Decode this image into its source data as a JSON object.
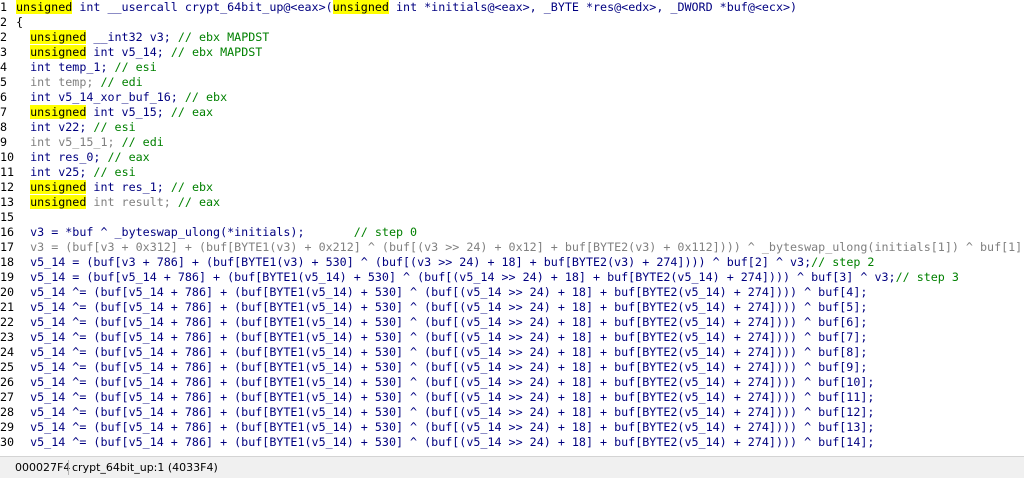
{
  "code": {
    "header": {
      "l1": "unsigned",
      "l2": " int __usercall crypt_64bit_up@<eax>(",
      "l3": "unsigned",
      "l4": " int *initials@<eax>, _BYTE *res@<edx>, _DWORD *buf@<ecx>)"
    },
    "brace": "{",
    "decls": [
      {
        "n": "2",
        "kw": "unsigned",
        "type": " __int32 v3; ",
        "cmt": "// ebx MAPDST"
      },
      {
        "n": "3",
        "kw": "unsigned",
        "type": " int v5_14; ",
        "cmt": "// ebx MAPDST"
      },
      {
        "n": "4",
        "kw": "",
        "type": "int temp_1; ",
        "cmt": "// esi"
      },
      {
        "n": "5",
        "kw": "",
        "type": "int temp; ",
        "cmt": "// edi",
        "gray": true
      },
      {
        "n": "6",
        "kw": "",
        "type": "int v5_14_xor_buf_16; ",
        "cmt": "// ebx"
      },
      {
        "n": "7",
        "kw": "unsigned",
        "type": " int v5_15; ",
        "cmt": "// eax"
      },
      {
        "n": "8",
        "kw": "",
        "type": "int v22; ",
        "cmt": "// esi"
      },
      {
        "n": "9",
        "kw": "",
        "type": "int v5_15_1; ",
        "cmt": "// edi",
        "gray": true
      },
      {
        "n": "10",
        "kw": "",
        "type": "int res_0; ",
        "cmt": "// eax"
      },
      {
        "n": "11",
        "kw": "",
        "type": "int v25; ",
        "cmt": "// esi"
      },
      {
        "n": "12",
        "kw": "unsigned",
        "type": " int res_1; ",
        "cmt": "// ebx"
      },
      {
        "n": "13",
        "kw": "unsigned",
        "type": " int result; ",
        "cmt": "// eax",
        "gray": true
      }
    ],
    "stmts": [
      {
        "n": "16",
        "code": "v3 = *buf ^ _byteswap_ulong(*initials);       ",
        "cmt": "// step 0"
      },
      {
        "n": "17",
        "code": "v3 = (buf[v3 + 0x312] + (buf[BYTE1(v3) + 0x212] ^ (buf[(v3 >> 24) + 0x12] + buf[BYTE2(v3) + 0x112]))) ^ _byteswap_ulong(initials[1]) ^ buf[1];",
        "cmt": "",
        "gray": true
      },
      {
        "n": "18",
        "code": "v5_14 = (buf[v3 + 786] + (buf[BYTE1(v3) + 530] ^ (buf[(v3 >> 24) + 18] + buf[BYTE2(v3) + 274]))) ^ buf[2] ^ v3;",
        "cmt": "// step 2"
      },
      {
        "n": "19",
        "code": "v5_14 = (buf[v5_14 + 786] + (buf[BYTE1(v5_14) + 530] ^ (buf[(v5_14 >> 24) + 18] + buf[BYTE2(v5_14) + 274]))) ^ buf[3] ^ v3;",
        "cmt": "// step 3"
      },
      {
        "n": "20",
        "code": "v5_14 ^= (buf[v5_14 + 786] + (buf[BYTE1(v5_14) + 530] ^ (buf[(v5_14 >> 24) + 18] + buf[BYTE2(v5_14) + 274]))) ^ buf[4];",
        "cmt": ""
      },
      {
        "n": "21",
        "code": "v5_14 ^= (buf[v5_14 + 786] + (buf[BYTE1(v5_14) + 530] ^ (buf[(v5_14 >> 24) + 18] + buf[BYTE2(v5_14) + 274]))) ^ buf[5];",
        "cmt": ""
      },
      {
        "n": "22",
        "code": "v5_14 ^= (buf[v5_14 + 786] + (buf[BYTE1(v5_14) + 530] ^ (buf[(v5_14 >> 24) + 18] + buf[BYTE2(v5_14) + 274]))) ^ buf[6];",
        "cmt": ""
      },
      {
        "n": "23",
        "code": "v5_14 ^= (buf[v5_14 + 786] + (buf[BYTE1(v5_14) + 530] ^ (buf[(v5_14 >> 24) + 18] + buf[BYTE2(v5_14) + 274]))) ^ buf[7];",
        "cmt": ""
      },
      {
        "n": "24",
        "code": "v5_14 ^= (buf[v5_14 + 786] + (buf[BYTE1(v5_14) + 530] ^ (buf[(v5_14 >> 24) + 18] + buf[BYTE2(v5_14) + 274]))) ^ buf[8];",
        "cmt": ""
      },
      {
        "n": "25",
        "code": "v5_14 ^= (buf[v5_14 + 786] + (buf[BYTE1(v5_14) + 530] ^ (buf[(v5_14 >> 24) + 18] + buf[BYTE2(v5_14) + 274]))) ^ buf[9];",
        "cmt": ""
      },
      {
        "n": "26",
        "code": "v5_14 ^= (buf[v5_14 + 786] + (buf[BYTE1(v5_14) + 530] ^ (buf[(v5_14 >> 24) + 18] + buf[BYTE2(v5_14) + 274]))) ^ buf[10];",
        "cmt": ""
      },
      {
        "n": "27",
        "code": "v5_14 ^= (buf[v5_14 + 786] + (buf[BYTE1(v5_14) + 530] ^ (buf[(v5_14 >> 24) + 18] + buf[BYTE2(v5_14) + 274]))) ^ buf[11];",
        "cmt": ""
      },
      {
        "n": "28",
        "code": "v5_14 ^= (buf[v5_14 + 786] + (buf[BYTE1(v5_14) + 530] ^ (buf[(v5_14 >> 24) + 18] + buf[BYTE2(v5_14) + 274]))) ^ buf[12];",
        "cmt": ""
      },
      {
        "n": "29",
        "code": "v5_14 ^= (buf[v5_14 + 786] + (buf[BYTE1(v5_14) + 530] ^ (buf[(v5_14 >> 24) + 18] + buf[BYTE2(v5_14) + 274]))) ^ buf[13];",
        "cmt": ""
      },
      {
        "n": "30",
        "code": "v5_14 ^= (buf[v5_14 + 786] + (buf[BYTE1(v5_14) + 530] ^ (buf[(v5_14 >> 24) + 18] + buf[BYTE2(v5_14) + 274]))) ^ buf[14];",
        "cmt": ""
      }
    ],
    "line_numbers": {
      "first": "1",
      "brace": "2",
      "blank": "15"
    }
  },
  "status": {
    "address": "000027F4",
    "function": "crypt_64bit_up:1 (4033F4)"
  },
  "colors": {
    "keyword_highlight": "#ffff00",
    "code_text": "#000080",
    "comment": "#008000",
    "dimmed": "#808080"
  }
}
